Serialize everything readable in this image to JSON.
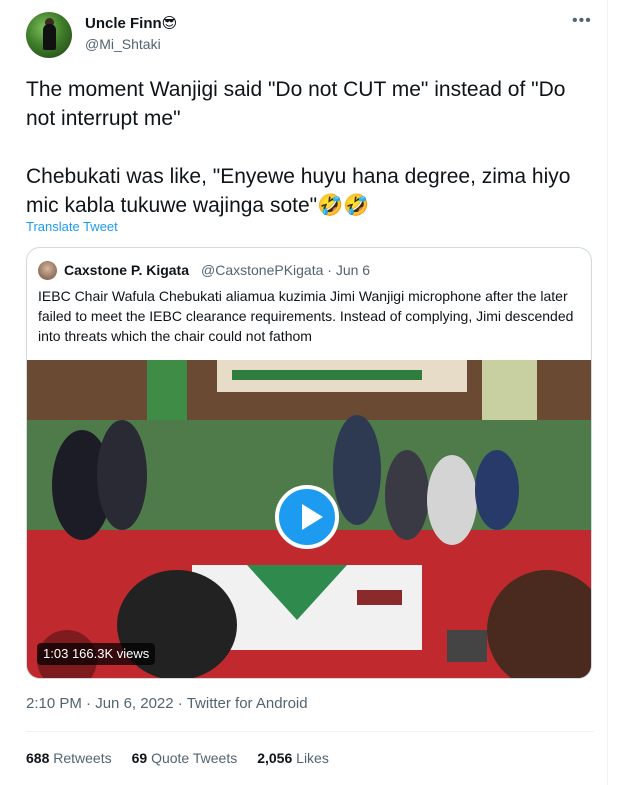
{
  "author": {
    "display_name": "Uncle Finn😎",
    "handle": "@Mi_Shtaki"
  },
  "tweet": {
    "text": "The moment Wanjigi said \"Do not CUT me\" instead of \"Do not interrupt me\"\n\nChebukati was like, \"Enyewe huyu hana degree, zima hiyo mic kabla tukuwe wajinga sote\"🤣🤣",
    "translate_label": "Translate Tweet"
  },
  "quote": {
    "display_name": "Caxstone P. Kigata",
    "handle": "@CaxstonePKigata",
    "separator": "·",
    "date": "Jun 6",
    "text": "IEBC Chair Wafula Chebukati aliamua kuzimia Jimi Wanjigi microphone after the later failed to meet the IEBC clearance requirements. Instead of complying, Jimi descended into threats which the chair could not fathom",
    "video": {
      "duration": "1:03",
      "views": "166.3K views",
      "icon": "play-icon"
    }
  },
  "meta": {
    "time": "2:10 PM",
    "separator": "·",
    "date": "Jun 6, 2022",
    "source": "Twitter for Android"
  },
  "stats": {
    "retweets_count": "688",
    "retweets_label": "Retweets",
    "quotes_count": "69",
    "quotes_label": "Quote Tweets",
    "likes_count": "2,056",
    "likes_label": "Likes"
  },
  "colors": {
    "accent": "#1d9bf0",
    "text": "#0f1419",
    "secondary": "#536471",
    "border": "#cfd9de"
  }
}
